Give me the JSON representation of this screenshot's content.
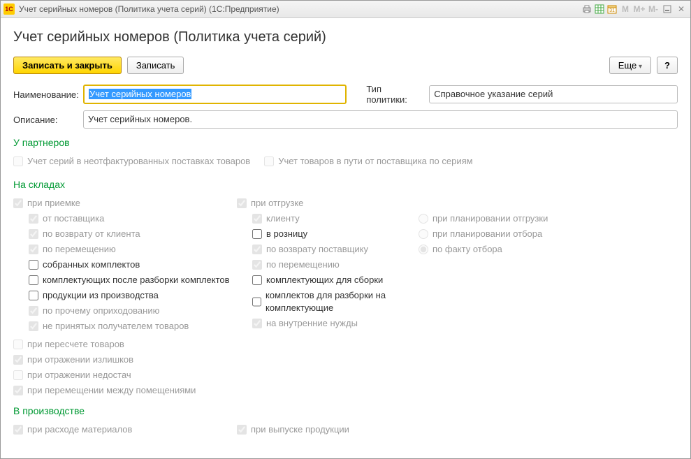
{
  "titlebar": {
    "logo_text": "1C",
    "title": "Учет серийных номеров (Политика учета серий)  (1С:Предприятие)",
    "btn_m1": "M",
    "btn_mplus": "M+",
    "btn_mminus": "M-",
    "btn_min": "🗕",
    "btn_close": "✕"
  },
  "header": {
    "title": "Учет серийных номеров (Политика учета серий)"
  },
  "toolbar": {
    "save_close": "Записать и закрыть",
    "save": "Записать",
    "more": "Еще",
    "help": "?"
  },
  "fields": {
    "name_label": "Наименование:",
    "name_value": "Учет серийных номеров",
    "policy_label": "Тип политики:",
    "policy_value": "Справочное указание серий",
    "desc_label": "Описание:",
    "desc_value": "Учет серийных номеров."
  },
  "sec_partners": {
    "title": "У партнеров",
    "chk1": "Учет серий в неотфактурованных поставках товаров",
    "chk2": "Учет товаров в пути от поставщика по сериям"
  },
  "sec_wh": {
    "title": "На складах",
    "col1": {
      "head": "при приемке",
      "i1": "от поставщика",
      "i2": "по возврату от клиента",
      "i3": "по перемещению",
      "i4": "собранных комплектов",
      "i5": "комплектующих после разборки комплектов",
      "i6": "продукции из производства",
      "i7": "по прочему оприходованию",
      "i8": "не принятых получателем товаров"
    },
    "col2": {
      "head": "при отгрузке",
      "i1": "клиенту",
      "i2": "в розницу",
      "i3": "по возврату поставщику",
      "i4": "по перемещению",
      "i5": "комплектующих для сборки",
      "i6": "комплектов для разборки на комплектующие",
      "i7": "на внутренние нужды"
    },
    "col3": {
      "r1": "при планировании отгрузки",
      "r2": "при планировании отбора",
      "r3": "по факту отбора"
    },
    "extra": {
      "e1": "при пересчете товаров",
      "e2": "при отражении излишков",
      "e3": "при отражении недостач",
      "e4": "при перемещении между помещениями"
    }
  },
  "sec_prod": {
    "title": "В производстве",
    "c1": "при расходе материалов",
    "c2": "при выпуске продукции"
  }
}
